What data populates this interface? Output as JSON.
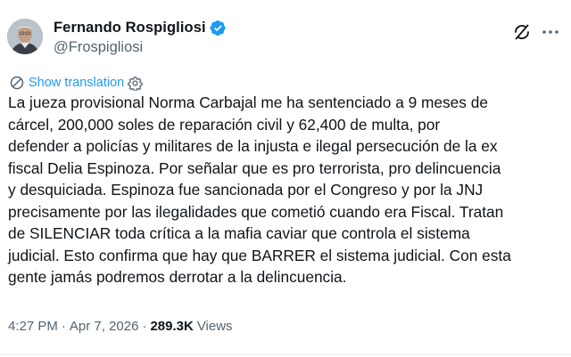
{
  "author": {
    "display_name": "Fernando Rospigliosi",
    "handle": "@Frospigliosi",
    "verified": true,
    "avatar_icon": "profile-photo"
  },
  "actions": {
    "grok_icon": "grok-icon",
    "more_icon": "more-icon"
  },
  "translate": {
    "label": "Show translation",
    "icon": "translate-icon",
    "settings_icon": "gear-icon"
  },
  "tweet": {
    "text": "La jueza provisional Norma Carbajal me ha sentenciado a 9 meses de\ncárcel, 200,000 soles de reparación civil y 62,400 de multa, por\ndefender a policías y militares de la injusta e ilegal persecución de la ex\nfiscal Delia Espinoza. Por señalar que es pro terrorista, pro delincuencia\ny desquiciada. Espinoza fue sancionada por el Congreso y por la JNJ\nprecisamente por las ilegalidades que cometió cuando era Fiscal. Tratan\nde SILENCIAR toda crítica a la mafia caviar que controla el sistema\njudicial. Esto confirma que hay que BARRER el sistema judicial. Con esta\ngente jamás podremos derrotar a la delincuencia."
  },
  "meta": {
    "time": "4:27 PM",
    "separator": "·",
    "date": "Apr 7, 2026",
    "views_count": "289.3K",
    "views_label": "Views"
  },
  "colors": {
    "accent": "#1d9bf0",
    "text": "#0f1419",
    "secondary": "#536471"
  }
}
